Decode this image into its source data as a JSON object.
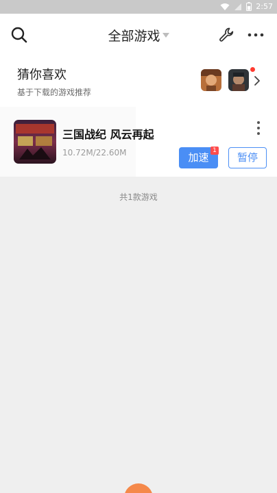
{
  "status_bar": {
    "time": "2:57",
    "icons": [
      "wifi-icon",
      "signal-icon",
      "battery-icon"
    ]
  },
  "header": {
    "title": "全部游戏",
    "icons": [
      "search-icon",
      "caret-down-icon",
      "wrench-icon",
      "more-horizontal-icon"
    ]
  },
  "recommend": {
    "title": "猜你喜欢",
    "subtitle": "基于下载的游戏推荐",
    "avatars": [
      "game-avatar-1",
      "game-avatar-2"
    ],
    "has_notification_dot": true
  },
  "games": [
    {
      "name": "三国战纪 风云再起",
      "progress": "10.72M/22.60M",
      "accelerate_label": "加速",
      "accelerate_badge": "1",
      "pause_label": "暂停"
    }
  ],
  "game_count": "共1款游戏",
  "colors": {
    "accent": "#4a8ef5",
    "badge": "#ff4d4d",
    "background": "#efefef",
    "fab": "#f5894a"
  }
}
